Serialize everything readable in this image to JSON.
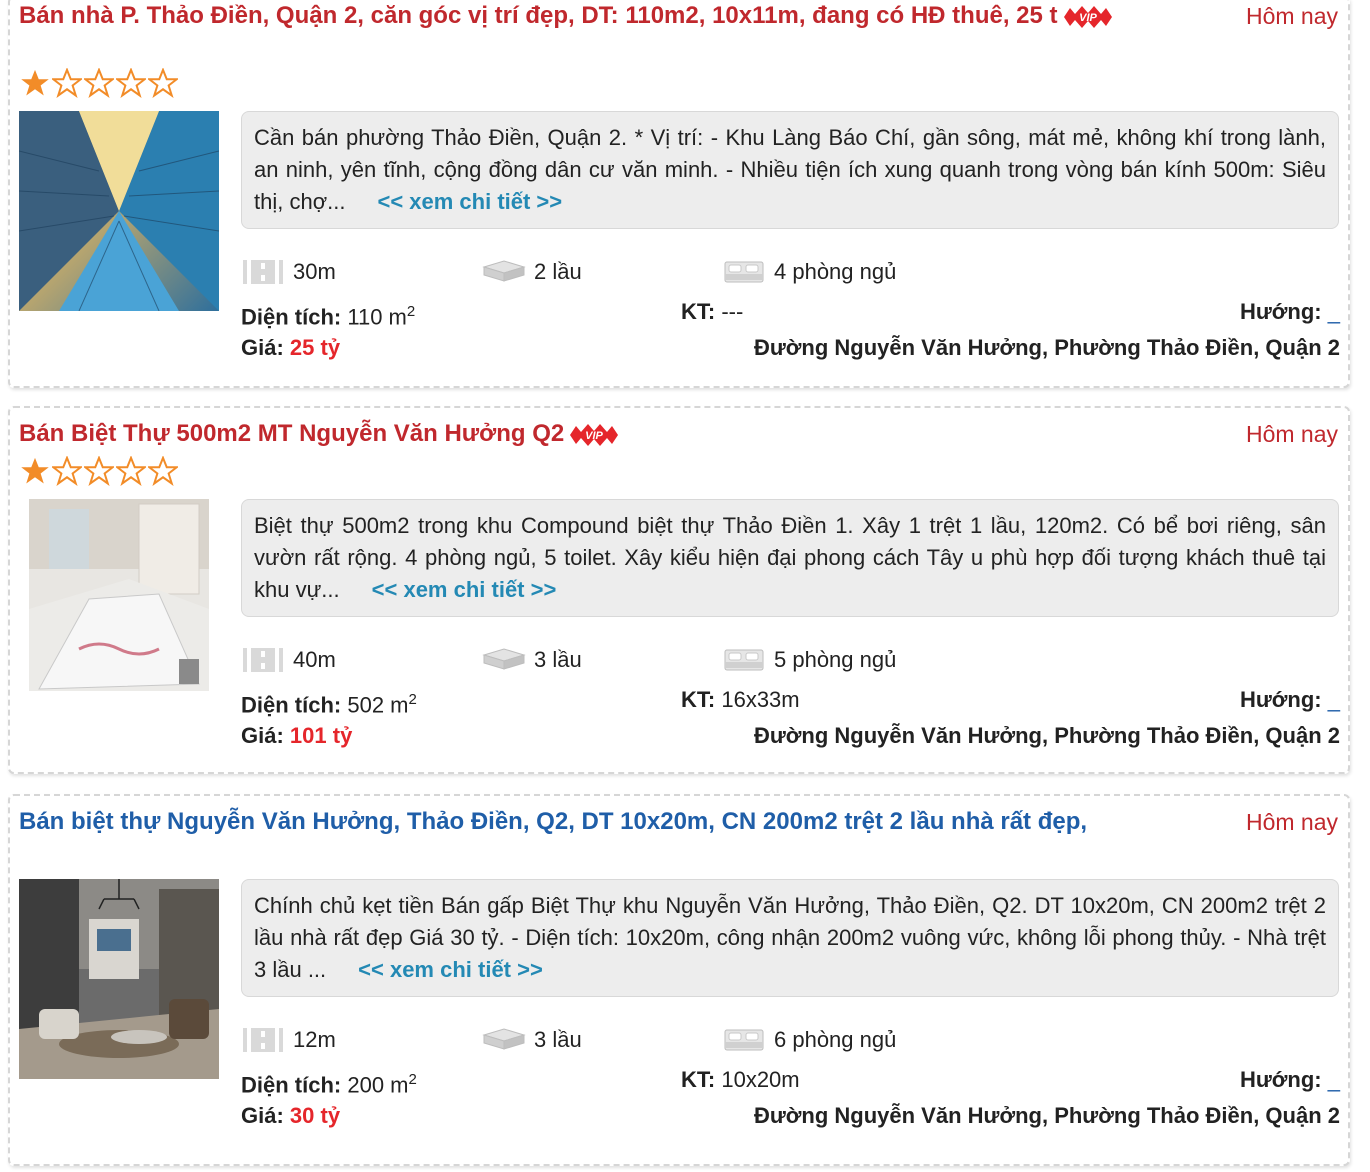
{
  "listings": [
    {
      "title": "Bán nhà P. Thảo Điền, Quận 2, căn góc vị trí đẹp, DT: 110m2, 10x11m, đang có HĐ thuê, 25 t",
      "title_style": "vip",
      "vip": true,
      "date": "Hôm nay",
      "rating": 1,
      "rating_max": 5,
      "description": "Cần bán phường Thảo Điền, Quận 2. * Vị trí: - Khu Làng Báo Chí, gần sông, mát mẻ, không khí trong lành, an ninh, yên tĩnh, cộng đồng dân cư văn minh. - Nhiều tiện ích xung quanh trong vòng bán kính 500m: Siêu thị, chợ...",
      "more_link": "<< xem chi tiết >>",
      "road_width": "30m",
      "floors": "2 lầu",
      "bedrooms": "4 phòng ngủ",
      "area_label": "Diện tích:",
      "area_value": "110 m",
      "area_unit_sup": "2",
      "kt_label": "KT:",
      "kt_value": "---",
      "direction_label": "Hướng:",
      "direction_value": "_",
      "price_label": "Giá:",
      "price_value": "25 tỷ",
      "address": "Đường Nguyễn Văn Hưởng, Phường Thảo Điền, Quận 2",
      "image": "building-photo"
    },
    {
      "title": "Bán Biệt Thự 500m2 MT Nguyễn Văn Hưởng Q2",
      "title_style": "vip",
      "vip": true,
      "date": "Hôm nay",
      "rating": 1,
      "rating_max": 5,
      "description": "Biệt thự 500m2 trong khu Compound biệt thự Thảo Điền 1. Xây 1 trệt 1 lầu, 120m2. Có bể bơi riêng, sân vườn rất rộng. 4 phòng ngủ, 5 toilet. Xây kiểu hiện đại phong cách Tây u phù hợp đối tượng khách thuê tại khu vự...",
      "more_link": "<< xem chi tiết >>",
      "road_width": "40m",
      "floors": "3 lầu",
      "bedrooms": "5 phòng ngủ",
      "area_label": "Diện tích:",
      "area_value": "502 m",
      "area_unit_sup": "2",
      "kt_label": "KT:",
      "kt_value": "16x33m",
      "direction_label": "Hướng:",
      "direction_value": "_",
      "price_label": "Giá:",
      "price_value": "101 tỷ",
      "address": "Đường Nguyễn Văn Hưởng, Phường Thảo Điền, Quận 2",
      "image": "interior-photo"
    },
    {
      "title": "Bán biệt thự Nguyễn Văn Hưởng, Thảo Điền, Q2, DT 10x20m, CN 200m2 trệt 2 lầu nhà rất đẹp,",
      "title_style": "normal",
      "vip": false,
      "date": "Hôm nay",
      "rating": 0,
      "rating_max": 0,
      "description": "Chính chủ kẹt tiền Bán gấp Biệt Thự khu Nguyễn Văn Hưởng, Thảo Điền, Q2. DT 10x20m, CN 200m2 trệt 2 lầu nhà rất đẹp Giá 30 tỷ. - Diện tích: 10x20m, công nhận 200m2 vuông vức, không lỗi phong thủy. - Nhà trệt 3 lầu ...",
      "more_link": "<< xem chi tiết >>",
      "road_width": "12m",
      "floors": "3 lầu",
      "bedrooms": "6 phòng ngủ",
      "area_label": "Diện tích:",
      "area_value": "200 m",
      "area_unit_sup": "2",
      "kt_label": "KT:",
      "kt_value": "10x20m",
      "direction_label": "Hướng:",
      "direction_value": "_",
      "price_label": "Giá:",
      "price_value": "30 tỷ",
      "address": "Đường Nguyễn Văn Hưởng, Phường Thảo Điền, Quận 2",
      "image": "living-room-photo"
    }
  ],
  "vip_badge_text": "VIP",
  "colors": {
    "vip_title": "#c0282d",
    "normal_title": "#1f5ea8",
    "price": "#e5262b",
    "more_link": "#2489b4",
    "star": "#f28c28"
  }
}
